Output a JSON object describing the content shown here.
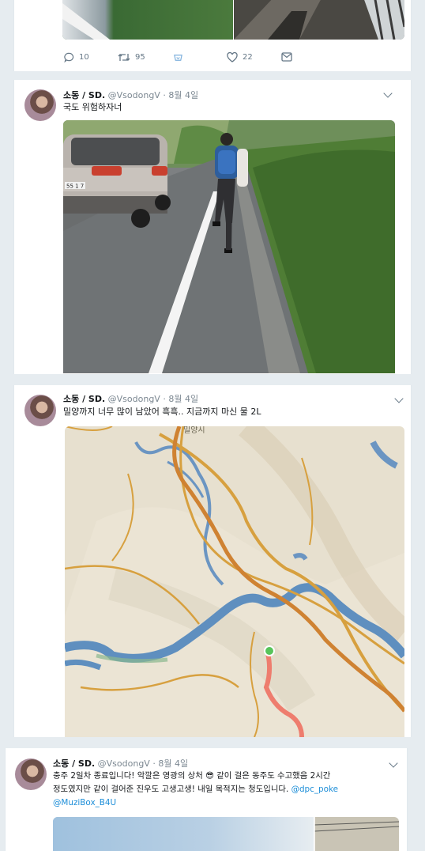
{
  "tweet1": {
    "actions": {
      "reply_count": "10",
      "retweet_count": "95",
      "like_count": "22"
    }
  },
  "tweet2": {
    "name": "소동 / SD.",
    "handle": "@VsodongV",
    "date": "· 8월 4일",
    "text": "국도 위험하자너",
    "car_plate": "55 1 7"
  },
  "tweet3": {
    "name": "소동 / SD.",
    "handle": "@VsodongV",
    "date": "· 8월 4일",
    "text": "밀양까지 너무 많이 남았어 흑흑.. 지금까지 마신 물 2L",
    "map_label": "밀양시"
  },
  "tweet4": {
    "name": "소동 / SD.",
    "handle": "@VsodongV",
    "date": "· 8월 4일",
    "line1": "충주 2일차 종료입니다! 악깔은 영광의 상처 😎 같이 걸은 동주도 수고했음 2시간",
    "line2_text": "정도였지만 같이 걸어준 진우도 고생고생! 내일 목적지는 청도입니다. ",
    "mention1": "@dpc_poke",
    "mention2": "@MuziBox_B4U"
  },
  "icons": [
    "reply-icon",
    "retweet-icon",
    "heart-icon",
    "message-icon",
    "chevron-down-icon"
  ]
}
